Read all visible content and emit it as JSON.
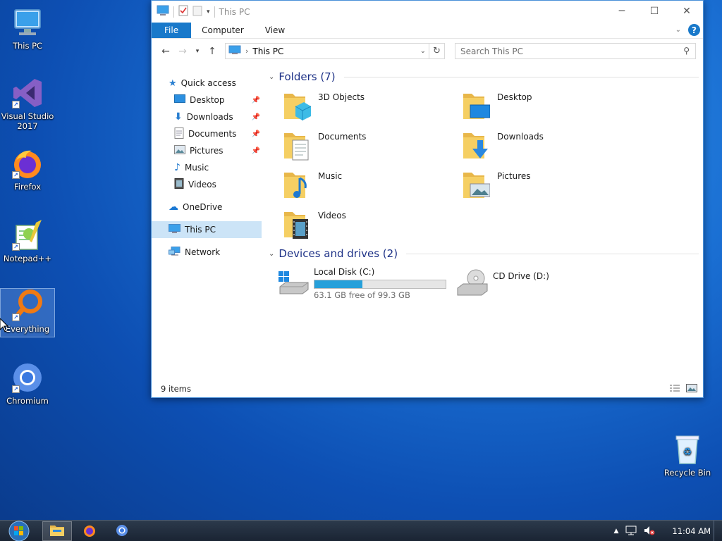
{
  "desktop": {
    "icons": [
      {
        "label": "This PC",
        "icon": "this-pc-icon"
      },
      {
        "label": "Visual Studio 2017",
        "icon": "visual-studio-icon"
      },
      {
        "label": "Firefox",
        "icon": "firefox-icon"
      },
      {
        "label": "Notepad++",
        "icon": "notepadpp-icon"
      },
      {
        "label": "Everything",
        "icon": "everything-icon"
      },
      {
        "label": "Chromium",
        "icon": "chromium-icon"
      },
      {
        "label": "Recycle Bin",
        "icon": "recycle-bin-icon"
      }
    ]
  },
  "window": {
    "title": "This PC",
    "tabs": [
      "File",
      "Computer",
      "View"
    ],
    "address": {
      "root_icon": "this-pc-icon",
      "crumb": "This PC"
    },
    "search_placeholder": "Search This PC",
    "nav": {
      "quick_access": "Quick access",
      "pinned": [
        {
          "label": "Desktop",
          "icon": "desktop-icon"
        },
        {
          "label": "Downloads",
          "icon": "downloads-icon"
        },
        {
          "label": "Documents",
          "icon": "documents-icon"
        },
        {
          "label": "Pictures",
          "icon": "pictures-icon"
        }
      ],
      "others": [
        {
          "label": "Music",
          "icon": "music-icon"
        },
        {
          "label": "Videos",
          "icon": "videos-icon"
        }
      ],
      "onedrive": "OneDrive",
      "this_pc": "This PC",
      "network": "Network"
    },
    "folders_header": "Folders (7)",
    "folders": [
      "3D Objects",
      "Desktop",
      "Documents",
      "Downloads",
      "Music",
      "Pictures",
      "Videos"
    ],
    "drives_header": "Devices and drives (2)",
    "drives": {
      "c": {
        "name": "Local Disk (C:)",
        "free_text": "63.1 GB free of 99.3 GB",
        "used_fraction": 0.365
      },
      "d": {
        "name": "CD Drive (D:)"
      }
    },
    "status": "9 items"
  },
  "taskbar": {
    "apps": [
      "file-explorer-icon",
      "firefox-icon",
      "chromium-icon"
    ],
    "time": "11:04 AM"
  },
  "colors": {
    "accent": "#1979ca",
    "drive_fill": "#26a0da",
    "header_blue": "#1e3287"
  }
}
